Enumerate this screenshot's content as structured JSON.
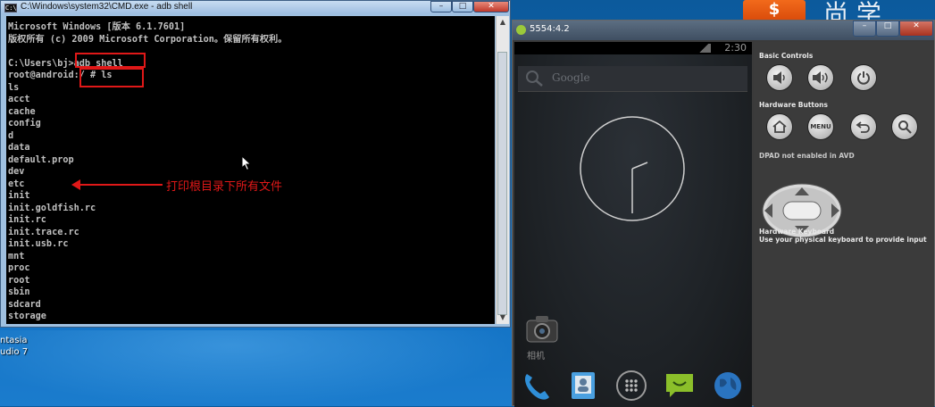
{
  "desktop": {
    "icons": [
      "ntasia",
      "udio 7"
    ]
  },
  "cmd": {
    "title": "C:\\Windows\\system32\\CMD.exe - adb  shell",
    "icon": "console-icon",
    "lines": [
      "Microsoft Windows [版本 6.1.7601]",
      "版权所有 (c) 2009 Microsoft Corporation。保留所有权利。",
      "",
      "C:\\Users\\bj>adb shell",
      "root@android:/ # ls",
      "ls",
      "acct",
      "cache",
      "config",
      "d",
      "data",
      "default.prop",
      "dev",
      "etc",
      "init",
      "init.goldfish.rc",
      "init.rc",
      "init.trace.rc",
      "init.usb.rc",
      "mnt",
      "proc",
      "root",
      "sbin",
      "sdcard",
      "storage"
    ],
    "annotation": "打印根目录下所有文件",
    "window_buttons": {
      "minimize": "–",
      "maximize": "□",
      "close": "✕"
    }
  },
  "background_app": {
    "logo_text": "$",
    "title_text": "尚 学"
  },
  "emulator": {
    "title": "5554:4.2",
    "window_buttons": {
      "minimize": "–",
      "maximize": "□",
      "close": "✕"
    },
    "screen": {
      "status_time": "2:30",
      "search_placeholder": "Google",
      "camera_label": "相机",
      "dock_apps": [
        "phone-icon",
        "contacts-icon",
        "app-drawer-icon",
        "messaging-icon",
        "browser-icon"
      ]
    },
    "controls": {
      "basic_controls_label": "Basic Controls",
      "hardware_buttons_label": "Hardware Buttons",
      "menu_label": "MENU",
      "dpad_label": "DPAD not enabled in AVD",
      "hardware_keyboard_label": "Hardware Keyboard",
      "keyboard_hint": "Use your physical keyboard to provide input"
    }
  },
  "colors": {
    "annotation_red": "#e01818",
    "console_text": "#c0c0c0",
    "desktop_blue": "#0a66b2"
  }
}
